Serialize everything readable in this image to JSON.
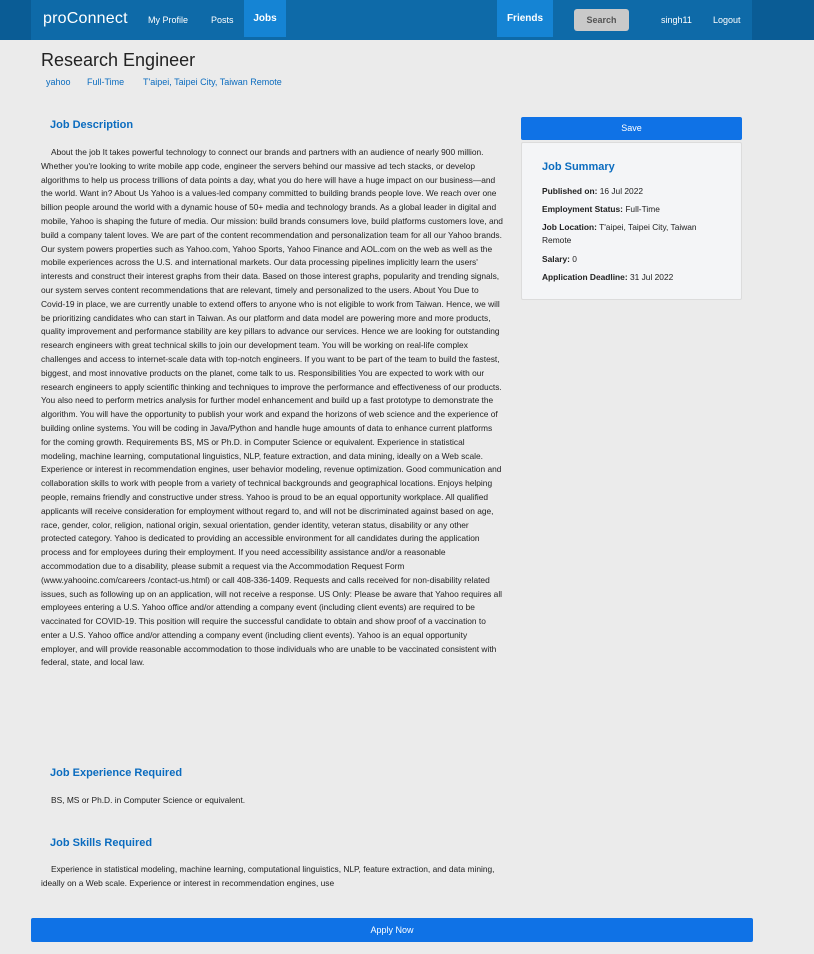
{
  "nav": {
    "brand": "proConnect",
    "my_profile": "My Profile",
    "posts": "Posts",
    "jobs": "Jobs",
    "friends": "Friends",
    "search": "Search",
    "username": "singh11",
    "logout": "Logout"
  },
  "job": {
    "title": "Research Engineer",
    "company": "yahoo",
    "type": "Full-Time",
    "location": "T'aipei, Taipei City, Taiwan Remote"
  },
  "sections": {
    "description_title": "Job Description",
    "description": "About the job It takes powerful technology to connect our brands and partners with an audience of nearly 900 million. Whether you're looking to write mobile app code, engineer the servers behind our massive ad tech stacks, or develop algorithms to help us process trillions of data points a day, what you do here will have a huge impact on our business—and the world. Want in? About Us Yahoo is a values-led company committed to building brands people love. We reach over one billion people around the world with a dynamic house of 50+ media and technology brands. As a global leader in digital and mobile, Yahoo is shaping the future of media. Our mission: build brands consumers love, build platforms customers love, and build a company talent loves. We are part of the content recommendation and personalization team for all our Yahoo brands. Our system powers properties such as Yahoo.com, Yahoo Sports, Yahoo Finance and AOL.com on the web as well as the mobile experiences across the U.S. and international markets. Our data processing pipelines implicitly learn the users' interests and construct their interest graphs from their data. Based on those interest graphs, popularity and trending signals, our system serves content recommendations that are relevant, timely and personalized to the users. About You Due to Covid-19 in place, we are currently unable to extend offers to anyone who is not eligible to work from Taiwan. Hence, we will be prioritizing candidates who can start in Taiwan. As our platform and data model are powering more and more products, quality improvement and performance stability are key pillars to advance our services. Hence we are looking for outstanding research engineers with great technical skills to join our development team. You will be working on real-life complex challenges and access to internet-scale data with top-notch engineers. If you want to be part of the team to build the fastest, biggest, and most innovative products on the planet, come talk to us. Responsibilities You are expected to work with our research engineers to apply scientific thinking and techniques to improve the performance and effectiveness of our products. You also need to perform metrics analysis for further model enhancement and build up a fast prototype to demonstrate the algorithm. You will have the opportunity to publish your work and expand the horizons of web science and the experience of building online systems. You will be coding in Java/Python and handle huge amounts of data to enhance current platforms for the coming growth. Requirements BS, MS or Ph.D. in Computer Science or equivalent. Experience in statistical modeling, machine learning, computational linguistics, NLP, feature extraction, and data mining, ideally on a Web scale. Experience or interest in recommendation engines, user behavior modeling, revenue optimization. Good communication and collaboration skills to work with people from a variety of technical backgrounds and geographical locations. Enjoys helping people, remains friendly and constructive under stress. Yahoo is proud to be an equal opportunity workplace. All qualified applicants will receive consideration for employment without regard to, and will not be discriminated against based on age, race, gender, color, religion, national origin, sexual orientation, gender identity, veteran status, disability or any other protected category. Yahoo is dedicated to providing an accessible environment for all candidates during the application process and for employees during their employment. If you need accessibility assistance and/or a reasonable accommodation due to a disability, please submit a request via the Accommodation Request Form (www.yahooinc.com/careers /contact-us.html) or call 408-336-1409. Requests and calls received for non-disability related issues, such as following up on an application, will not receive a response. US Only: Please be aware that Yahoo requires all employees entering a U.S. Yahoo office and/or attending a company event (including client events) are required to be vaccinated for COVID-19. This position will require the successful candidate to obtain and show proof of a vaccination to enter a U.S. Yahoo office and/or attending a company event (including client events). Yahoo is an equal opportunity employer, and will provide reasonable accommodation to those individuals who are unable to be vaccinated consistent with federal, state, and local law.",
    "experience_title": "Job Experience Required",
    "experience": "BS, MS or Ph.D. in Computer Science or equivalent.",
    "skills_title": "Job Skills Required",
    "skills": "Experience in statistical modeling, machine learning, computational linguistics, NLP, feature extraction, and data mining, ideally on a Web scale. Experience or interest in recommendation engines, use"
  },
  "summary": {
    "title": "Job Summary",
    "published_label": "Published on:",
    "published_value": "16 Jul 2022",
    "status_label": "Employment Status:",
    "status_value": "Full-Time",
    "location_label": "Job Location:",
    "location_value": "T'aipei, Taipei City, Taiwan Remote",
    "salary_label": "Salary:",
    "salary_value": "0",
    "deadline_label": "Application Deadline:",
    "deadline_value": "31 Jul 2022"
  },
  "buttons": {
    "save": "Save",
    "apply": "Apply Now"
  }
}
